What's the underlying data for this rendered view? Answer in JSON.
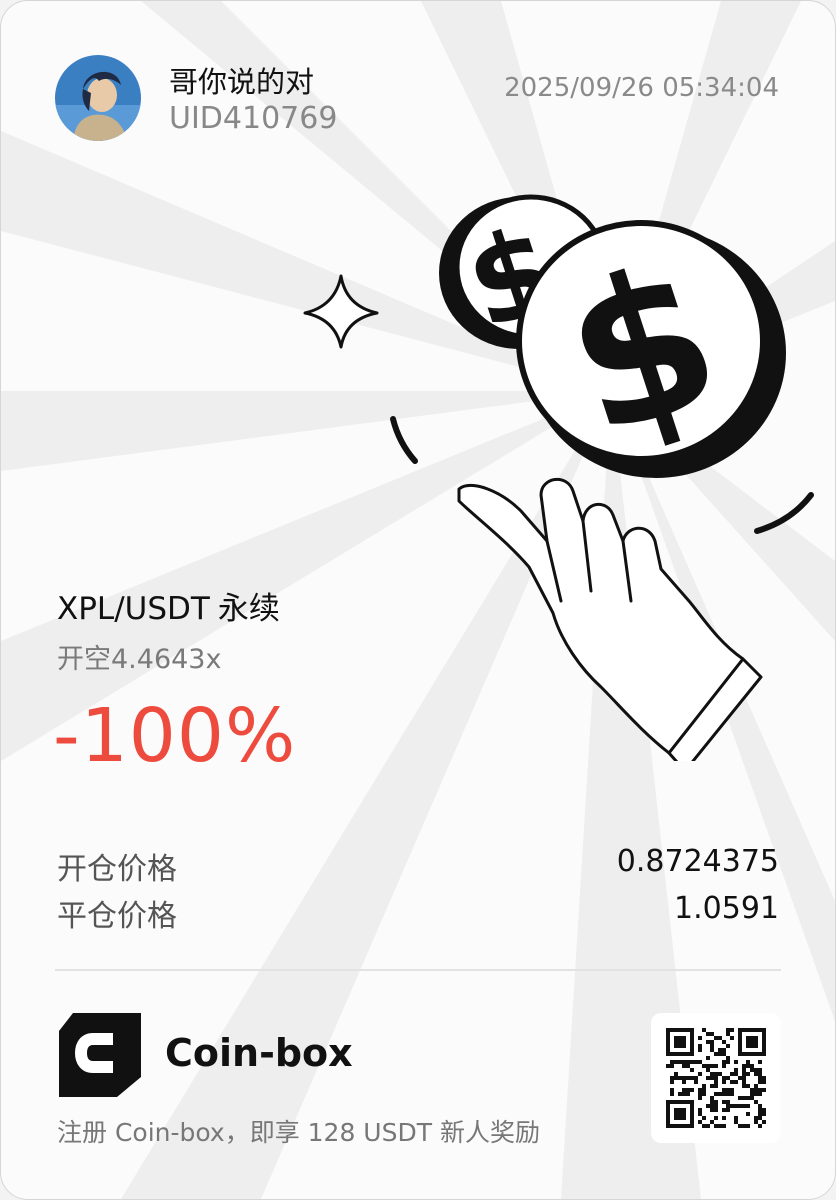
{
  "user": {
    "name": "哥你说的对",
    "uid": "UID410769"
  },
  "timestamp": "2025/09/26 05:34:04",
  "illustration": {
    "icons": [
      "sparkle-icon",
      "dollar-coin-icon",
      "hand-icon"
    ]
  },
  "trade": {
    "pair": "XPL/USDT",
    "contract_type": "永续",
    "side_leverage": "开空4.4643x",
    "pnl_percent": "-100%",
    "pnl_color": "#ee4b3f",
    "rows": [
      {
        "label": "开仓价格",
        "value": "0.8724375"
      },
      {
        "label": "平仓价格",
        "value": "1.0591"
      }
    ]
  },
  "footer": {
    "brand_name": "Coin-box",
    "promo": "注册 Coin-box，即享 128 USDT 新人奖励",
    "qr_icon": "qr-code-icon"
  }
}
